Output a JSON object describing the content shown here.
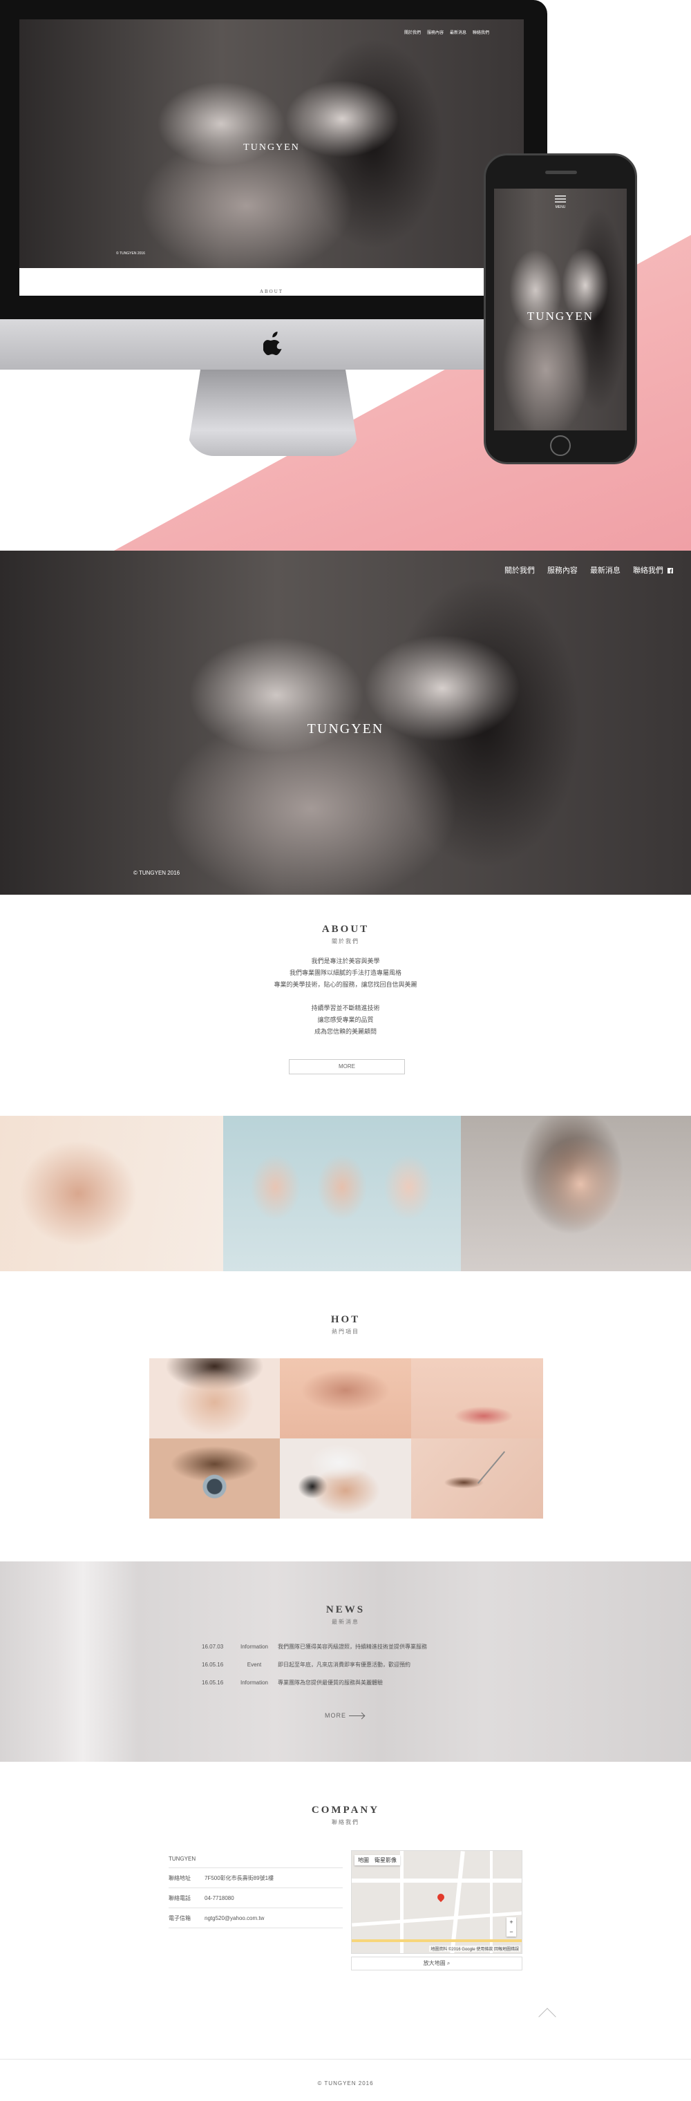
{
  "brand": "TUNGYEN",
  "nav": [
    "關於我們",
    "服務內容",
    "最新消息",
    "聯絡我們"
  ],
  "hero": {
    "title": "TUNGYEN",
    "copyright": "© TUNGYEN 2016"
  },
  "mockup": {
    "desktop_title": "TUNGYEN",
    "desktop_section": "ABOUT",
    "phone_title": "TUNGYEN",
    "phone_menu": "MENU",
    "desktop_copyright": "© TUNGYEN 2016"
  },
  "about": {
    "title": "ABOUT",
    "subtitle": "關於我們",
    "lines_1": [
      "我們是專注於美容與美學",
      "我們專業團隊以細膩的手法打造專屬風格",
      "專業的美學技術，貼心的服務，讓您找回自信與美麗"
    ],
    "lines_2": [
      "持續學習並不斷精進技術",
      "讓您感受專業的品質",
      "成為您信賴的美麗顧問"
    ],
    "more_label": "MORE"
  },
  "hot": {
    "title": "HOT",
    "subtitle": "熱門項目"
  },
  "news": {
    "title": "NEWS",
    "subtitle": "最新消息",
    "items": [
      {
        "date": "16.07.03",
        "category": "Information",
        "text": "我們團隊已獲得美容丙級證照，持續精進技術並提供專業服務"
      },
      {
        "date": "16.05.16",
        "category": "Event",
        "text": "即日起至年底，凡來店消費即享有優惠活動，歡迎預約"
      },
      {
        "date": "16.05.16",
        "category": "Information",
        "text": "專業團隊為您提供最優質的服務與美麗體驗"
      }
    ],
    "more_label": "MORE"
  },
  "company": {
    "title": "COMPANY",
    "subtitle": "聯絡我們",
    "name": "TUNGYEN",
    "rows": [
      {
        "label": "聯絡地址",
        "value": "7F500彰化市長壽街89號1樓"
      },
      {
        "label": "聯絡電話",
        "value": "04-7718080"
      },
      {
        "label": "電子信箱",
        "value": "ngtg520@yahoo.com.tw"
      }
    ],
    "map": {
      "tab_map": "地圖",
      "tab_satellite": "衛星影像",
      "zoom_in": "+",
      "zoom_out": "−",
      "credit": "地圖資料 ©2016 Google  使用條款  回報地圖錯誤"
    },
    "bigmap_label": "放大地圖"
  },
  "footer": {
    "copyright": "© TUNGYEN 2016"
  }
}
